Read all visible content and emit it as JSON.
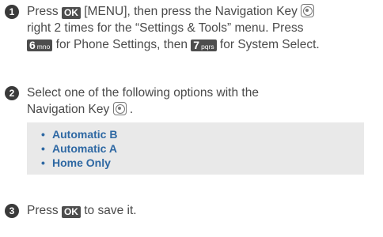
{
  "step1": {
    "number": "1",
    "t_press": "Press",
    "ok_key": "OK",
    "t_menu": " [MENU], then press the Navigation Key",
    "line2": "right 2 times for the “Settings & Tools” menu. Press",
    "key6_main": "6",
    "key6_sub": "mno",
    "t_phone": " for Phone Settings, then",
    "key7_main": "7",
    "key7_sub": "pqrs",
    "t_system": " for System Select."
  },
  "step2": {
    "number": "2",
    "line1": "Select one of the following options with the",
    "line2": "Navigation Key",
    "period": " ."
  },
  "options": {
    "bullet": "•",
    "items": [
      "Automatic B",
      "Automatic A",
      "Home Only"
    ]
  },
  "step3": {
    "number": "3",
    "t_press": "Press",
    "ok_key": "OK",
    "t_save": " to save it."
  },
  "colors": {
    "option_text": "#2e68a3",
    "key_bg": "#4d4d4d",
    "option_bg": "#e9e9e9"
  },
  "icons": {
    "navigation_key": "navigation-key-icon",
    "ok_key": "ok-key-icon"
  }
}
